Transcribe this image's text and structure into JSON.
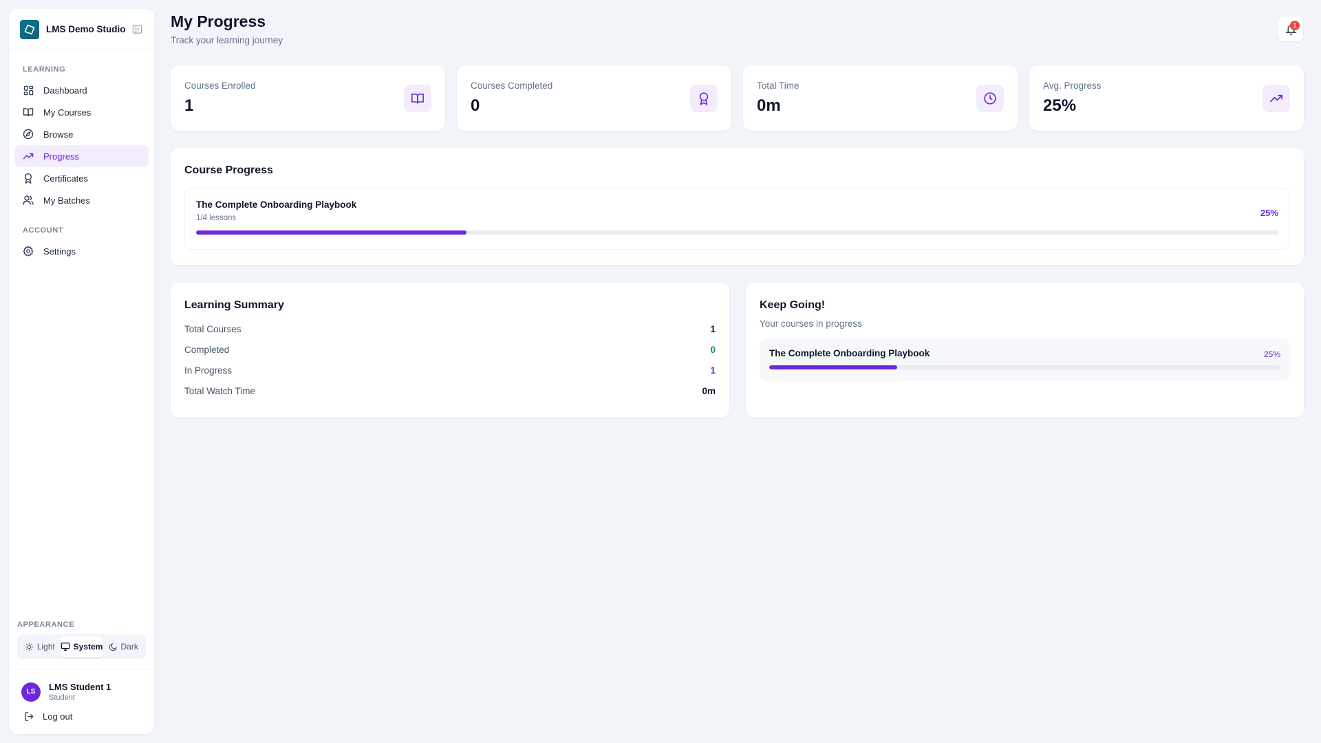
{
  "sidebar": {
    "brand_name": "LMS Demo Studio",
    "learning_heading": "LEARNING",
    "account_heading": "ACCOUNT",
    "items": [
      {
        "label": "Dashboard",
        "icon": "dashboard-icon"
      },
      {
        "label": "My Courses",
        "icon": "book-icon"
      },
      {
        "label": "Browse",
        "icon": "compass-icon"
      },
      {
        "label": "Progress",
        "icon": "trending-up-icon",
        "active": true
      },
      {
        "label": "Certificates",
        "icon": "award-icon"
      },
      {
        "label": "My Batches",
        "icon": "users-icon"
      }
    ],
    "account_items": [
      {
        "label": "Settings",
        "icon": "gear-icon"
      }
    ],
    "appearance_label": "APPEARANCE",
    "theme_options": [
      "Light",
      "System",
      "Dark"
    ],
    "theme_selected": "System",
    "user": {
      "initials": "LS",
      "name": "LMS Student 1",
      "role": "Student"
    },
    "logout_label": "Log out"
  },
  "header": {
    "title": "My Progress",
    "subtitle": "Track your learning journey",
    "notification_count": "1"
  },
  "stats": [
    {
      "label": "Courses Enrolled",
      "value": "1",
      "icon": "book-icon"
    },
    {
      "label": "Courses Completed",
      "value": "0",
      "icon": "award-icon"
    },
    {
      "label": "Total Time",
      "value": "0m",
      "icon": "clock-icon"
    },
    {
      "label": "Avg. Progress",
      "value": "25%",
      "icon": "trending-up-icon"
    }
  ],
  "course_progress": {
    "title": "Course Progress",
    "courses": [
      {
        "title": "The Complete Onboarding Playbook",
        "lessons": "1/4 lessons",
        "percent_label": "25%",
        "percent": 25
      }
    ]
  },
  "summary": {
    "title": "Learning Summary",
    "rows": [
      {
        "label": "Total Courses",
        "value": "1"
      },
      {
        "label": "Completed",
        "value": "0"
      },
      {
        "label": "In Progress",
        "value": "1"
      },
      {
        "label": "Total Watch Time",
        "value": "0m"
      }
    ]
  },
  "keep_going": {
    "title": "Keep Going!",
    "subtitle": "Your courses in progress",
    "courses": [
      {
        "title": "The Complete Onboarding Playbook",
        "percent_label": "25%",
        "percent": 25
      }
    ]
  },
  "colors": {
    "accent": "#6d28d9",
    "accent_bg": "#f3ecfd",
    "success": "#059669",
    "badge": "#ef4444",
    "brand_logo": "#0e7490"
  }
}
